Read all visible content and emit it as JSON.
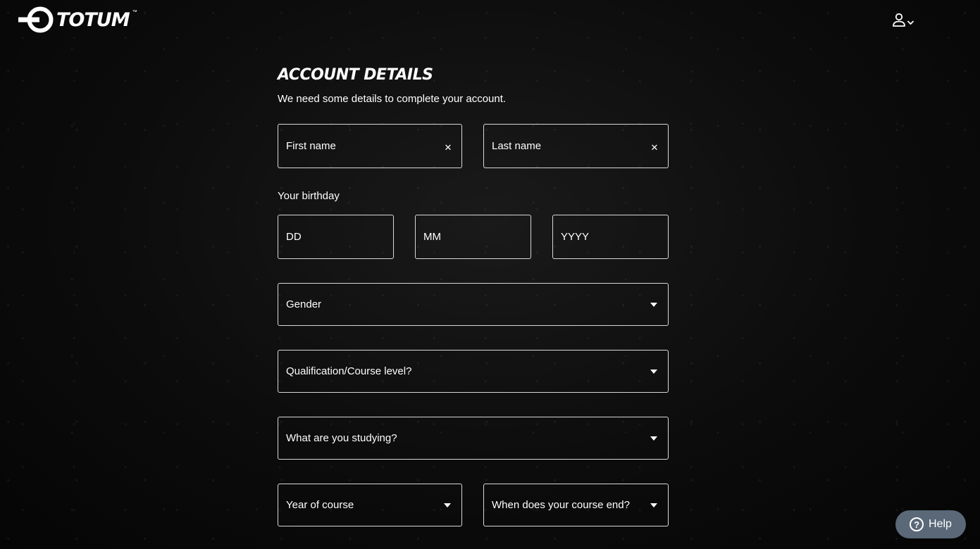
{
  "brand": {
    "name": "TOTUM",
    "trademark": "™"
  },
  "header": {
    "account_icon": "user-icon",
    "menu_icon": "chevron-down-icon"
  },
  "form": {
    "title": "ACCOUNT DETAILS",
    "subtitle": "We need some details to complete your account.",
    "first_name": {
      "placeholder": "First name",
      "clear_icon": "close-icon",
      "clear_glyph": "✕"
    },
    "last_name": {
      "placeholder": "Last name",
      "clear_icon": "close-icon",
      "clear_glyph": "✕"
    },
    "birthday": {
      "label": "Your birthday",
      "day": "DD",
      "month": "MM",
      "year": "YYYY"
    },
    "gender": {
      "placeholder": "Gender"
    },
    "qualification": {
      "placeholder": "Qualification/Course level?"
    },
    "studying": {
      "placeholder": "What are you studying?"
    },
    "year_of_course": {
      "placeholder": "Year of course"
    },
    "course_end": {
      "placeholder": "When does your course end?"
    }
  },
  "help": {
    "label": "Help",
    "icon_glyph": "?"
  },
  "colors": {
    "background": "#0c0c0c",
    "text": "#ffffff",
    "border": "#d8d8d8",
    "help_button": "#5a6878"
  }
}
